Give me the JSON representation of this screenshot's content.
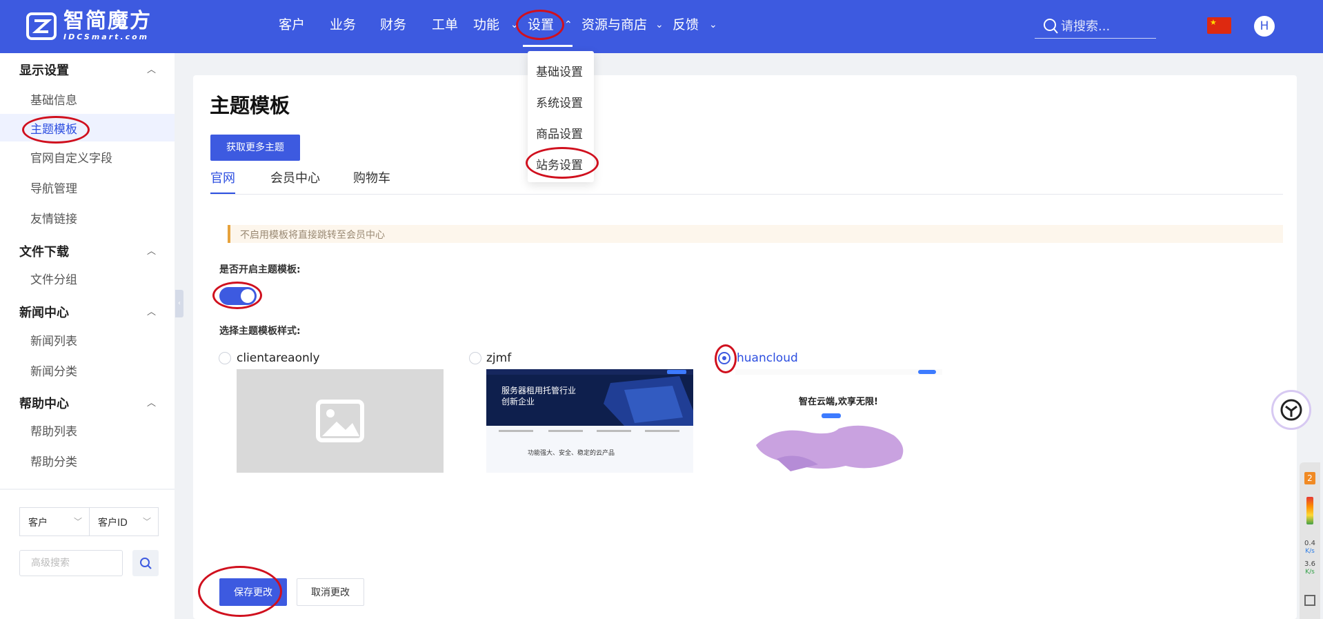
{
  "brand": {
    "name_cn": "智简魔方",
    "name_en": "IDCSmart.com",
    "color": "#3d5ae0"
  },
  "nav": {
    "items": [
      "客户",
      "业务",
      "财务",
      "工单",
      "功能",
      "设置",
      "资源与商店",
      "反馈"
    ],
    "active": "设置",
    "search_placeholder": "请搜索...",
    "avatar_letter": "H",
    "flag": "cn-flag-icon"
  },
  "settings_menu": [
    "基础设置",
    "系统设置",
    "商品设置",
    "站务设置"
  ],
  "sidebar": {
    "groups": [
      {
        "title": "显示设置",
        "items": [
          "基础信息",
          "主题模板",
          "官网自定义字段",
          "导航管理",
          "友情链接"
        ]
      },
      {
        "title": "文件下载",
        "items": [
          "文件分组"
        ]
      },
      {
        "title": "新闻中心",
        "items": [
          "新闻列表",
          "新闻分类"
        ]
      },
      {
        "title": "帮助中心",
        "items": [
          "帮助列表",
          "帮助分类"
        ]
      }
    ],
    "active_item": "主题模板",
    "filter_select_1": "客户",
    "filter_select_2": "客户ID",
    "advanced_search_placeholder": "高级搜索"
  },
  "main": {
    "title": "主题模板",
    "more_themes_button": "获取更多主题",
    "tabs": [
      "官网",
      "会员中心",
      "购物车"
    ],
    "active_tab": "官网",
    "notice": "不启用模板将直接跳转至会员中心",
    "enable_label": "是否开启主题模板:",
    "enabled": true,
    "style_label": "选择主题模板样式:",
    "themes": [
      {
        "name": "clientareaonly",
        "selected": false
      },
      {
        "name": "zjmf",
        "selected": false
      },
      {
        "name": "huancloud",
        "selected": true
      }
    ],
    "zjmf_preview": {
      "headline": "服务器租用托管行业",
      "subline": "创新企业",
      "footer": "功能强大、安全、稳定的云产品"
    },
    "huancloud_preview": {
      "headline": "智在云端,欢享无限!"
    },
    "save_button": "保存更改",
    "cancel_button": "取消更改"
  },
  "monitor": {
    "badge": "2",
    "up": "0.4",
    "down": "3.6",
    "unit": "K/s"
  },
  "annotation_color": "#d0101e"
}
